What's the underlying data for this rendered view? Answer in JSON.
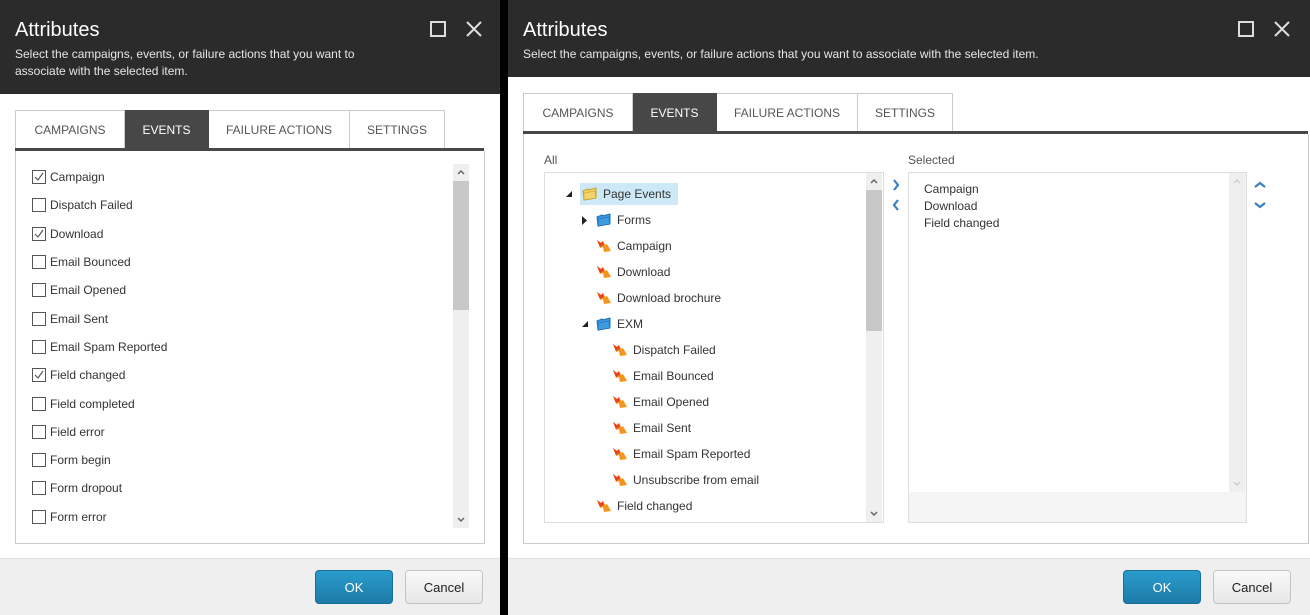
{
  "left_dialog": {
    "title": "Attributes",
    "subtitle": "Select the campaigns, events, or failure actions that you want to associate with the selected item.",
    "tabs": [
      {
        "label": "CAMPAIGNS",
        "active": false
      },
      {
        "label": "EVENTS",
        "active": true
      },
      {
        "label": "FAILURE ACTIONS",
        "active": false
      },
      {
        "label": "SETTINGS",
        "active": false
      }
    ],
    "events": [
      {
        "label": "Campaign",
        "checked": true
      },
      {
        "label": "Dispatch Failed",
        "checked": false
      },
      {
        "label": "Download",
        "checked": true
      },
      {
        "label": "Email Bounced",
        "checked": false
      },
      {
        "label": "Email Opened",
        "checked": false
      },
      {
        "label": "Email Sent",
        "checked": false
      },
      {
        "label": "Email Spam Reported",
        "checked": false
      },
      {
        "label": "Field changed",
        "checked": true
      },
      {
        "label": "Field completed",
        "checked": false
      },
      {
        "label": "Field error",
        "checked": false
      },
      {
        "label": "Form begin",
        "checked": false
      },
      {
        "label": "Form dropout",
        "checked": false
      },
      {
        "label": "Form error",
        "checked": false
      }
    ],
    "footer": {
      "ok_label": "OK",
      "cancel_label": "Cancel"
    }
  },
  "right_dialog": {
    "title": "Attributes",
    "subtitle": "Select the campaigns, events, or failure actions that you want to associate with the selected item.",
    "tabs": [
      {
        "label": "CAMPAIGNS",
        "active": false
      },
      {
        "label": "EVENTS",
        "active": true
      },
      {
        "label": "FAILURE ACTIONS",
        "active": false
      },
      {
        "label": "SETTINGS",
        "active": false
      }
    ],
    "all_label": "All",
    "selected_label": "Selected",
    "tree": [
      {
        "label": "Page Events",
        "icon": "folder-yellow-icon",
        "level": 0,
        "expander": "expanded",
        "selected": true
      },
      {
        "label": "Forms",
        "icon": "folder-blue-icon",
        "level": 1,
        "expander": "collapsed",
        "selected": false
      },
      {
        "label": "Campaign",
        "icon": "event-icon",
        "level": 1,
        "expander": "none",
        "selected": false
      },
      {
        "label": "Download",
        "icon": "event-icon",
        "level": 1,
        "expander": "none",
        "selected": false
      },
      {
        "label": "Download brochure",
        "icon": "event-icon",
        "level": 1,
        "expander": "none",
        "selected": false
      },
      {
        "label": "EXM",
        "icon": "folder-blue-icon",
        "level": 1,
        "expander": "expanded",
        "selected": false
      },
      {
        "label": "Dispatch Failed",
        "icon": "event-icon",
        "level": 2,
        "expander": "none",
        "selected": false
      },
      {
        "label": "Email Bounced",
        "icon": "event-icon",
        "level": 2,
        "expander": "none",
        "selected": false
      },
      {
        "label": "Email Opened",
        "icon": "event-icon",
        "level": 2,
        "expander": "none",
        "selected": false
      },
      {
        "label": "Email Sent",
        "icon": "event-icon",
        "level": 2,
        "expander": "none",
        "selected": false
      },
      {
        "label": "Email Spam Reported",
        "icon": "event-icon",
        "level": 2,
        "expander": "none",
        "selected": false
      },
      {
        "label": "Unsubscribe from email",
        "icon": "event-icon",
        "level": 2,
        "expander": "none",
        "selected": false
      },
      {
        "label": "Field changed",
        "icon": "event-icon",
        "level": 1,
        "expander": "none",
        "selected": false
      }
    ],
    "selected_items": [
      "Campaign",
      "Download",
      "Field changed"
    ],
    "footer": {
      "ok_label": "OK",
      "cancel_label": "Cancel"
    }
  },
  "colors": {
    "header_bg": "#2b2b2b",
    "active_tab_bg": "#474747",
    "ok_button": "#2a8fbd",
    "move_arrow": "#3a7fc1",
    "tree_selection": "#cde8f6"
  }
}
